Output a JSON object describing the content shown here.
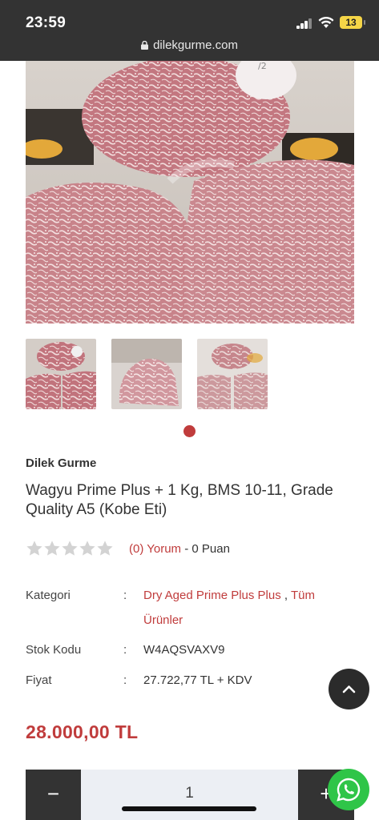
{
  "status_bar": {
    "time": "23:59",
    "battery": "13",
    "url": "dilekgurme.com",
    "icons": [
      "signal-icon",
      "wifi-icon",
      "battery-icon",
      "lock-icon"
    ]
  },
  "gallery": {
    "main_image": "wagyu-meat-photo",
    "thumbnails": [
      "wagyu-thumb-1",
      "wagyu-thumb-2",
      "wagyu-thumb-3"
    ],
    "active_dot": 1
  },
  "product": {
    "brand": "Dilek Gurme",
    "title": "Wagyu Prime Plus + 1 Kg, BMS 10-11, Grade Quality A5 (Kobe Eti)"
  },
  "rating": {
    "stars": 0,
    "max_stars": 5,
    "reviews_link": "(0) Yorum",
    "points": " - 0 Puan"
  },
  "specs": {
    "category_label": "Kategori",
    "colon": ":",
    "category_link_1": "Dry Aged Prime Plus Plus",
    "category_sep": " , ",
    "category_link_2": "Tüm",
    "category_link_2b": "Ürünler",
    "sku_label": "Stok Kodu",
    "sku_value": "W4AQSVAXV9",
    "price_label": "Fiyat",
    "price_value": "27.722,77 TL + KDV"
  },
  "price": {
    "total": "28.000,00 TL"
  },
  "quantity": {
    "minus": "−",
    "value": "1",
    "plus": "+"
  },
  "colors": {
    "accent": "#c03c3c",
    "dark": "#333333",
    "whatsapp": "#2fc548"
  }
}
